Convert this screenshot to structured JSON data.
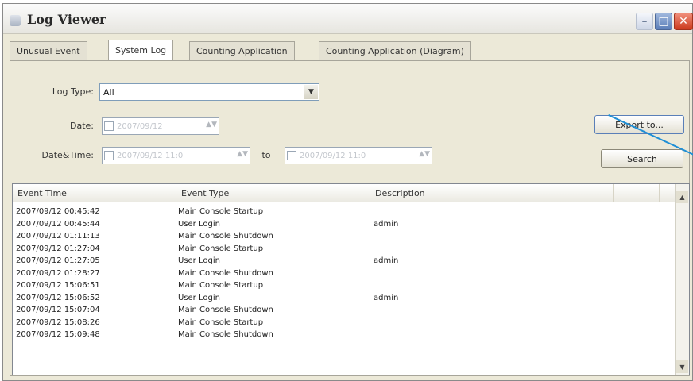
{
  "window": {
    "title": "Log Viewer",
    "controls": {
      "minimize": "–",
      "maximize": "□",
      "close": "✕"
    }
  },
  "tabs": [
    {
      "label": "Unusual Event",
      "active": false
    },
    {
      "label": "System Log",
      "active": true
    },
    {
      "label": "Counting Application",
      "active": false
    },
    {
      "label": "Counting Application (Diagram)",
      "active": false
    }
  ],
  "filters": {
    "log_type_label": "Log Type:",
    "log_type_value": "All",
    "date_label": "Date:",
    "date_value": "2007/09/12",
    "datetime_label": "Date&Time:",
    "datetime_from_value": "2007/09/12 11:0",
    "to_label": "to",
    "datetime_to_value": "2007/09/12 11:0"
  },
  "buttons": {
    "export": "Export to...",
    "search": "Search"
  },
  "table": {
    "columns": [
      "Event Time",
      "Event Type",
      "Description"
    ],
    "rows": [
      [
        "2007/09/12 00:45:42",
        "Main Console Startup",
        ""
      ],
      [
        "2007/09/12 00:45:44",
        "User Login",
        "admin"
      ],
      [
        "2007/09/12 01:11:13",
        "Main Console Shutdown",
        ""
      ],
      [
        "2007/09/12 01:27:04",
        "Main Console Startup",
        ""
      ],
      [
        "2007/09/12 01:27:05",
        "User Login",
        "admin"
      ],
      [
        "2007/09/12 01:28:27",
        "Main Console Shutdown",
        ""
      ],
      [
        "2007/09/12 15:06:51",
        "Main Console Startup",
        ""
      ],
      [
        "2007/09/12 15:06:52",
        "User Login",
        "admin"
      ],
      [
        "2007/09/12 15:07:04",
        "Main Console Shutdown",
        ""
      ],
      [
        "2007/09/12 15:08:26",
        "Main Console Startup",
        ""
      ],
      [
        "2007/09/12 15:09:48",
        "Main Console Shutdown",
        ""
      ]
    ]
  },
  "icons": {
    "scroll_up": "▲",
    "scroll_down": "▼",
    "dropdown": "▼"
  },
  "colors": {
    "accent_line": "#1f8fd6",
    "close_button": "#cc3a1d"
  }
}
